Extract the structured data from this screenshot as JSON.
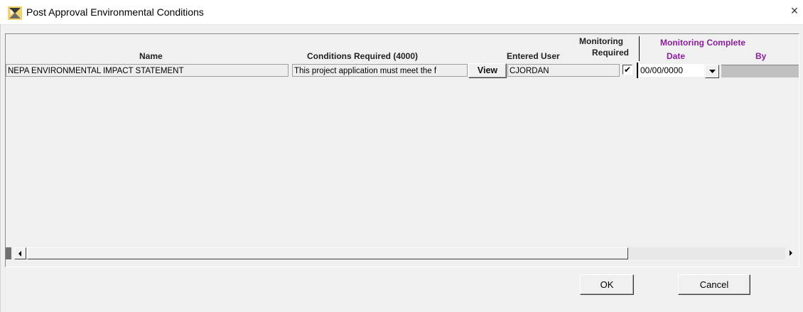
{
  "window": {
    "title": "Post Approval Environmental Conditions",
    "close_glyph": "×",
    "icon": "app-logo-icon"
  },
  "headers": {
    "name": "Name",
    "conditions": "Conditions Required (4000)",
    "entered_user": "Entered User",
    "monitoring_required_line1": "Monitoring",
    "monitoring_required_line2": "Required",
    "monitoring_complete": "Monitoring Complete",
    "date": "Date",
    "by": "By"
  },
  "rows": [
    {
      "name": "NEPA ENVIRONMENTAL IMPACT STATEMENT",
      "conditions": "This project application must meet the f",
      "view_label": "View",
      "entered_user": "CJORDAN",
      "monitoring_required": true,
      "checkbox_glyph": "✔",
      "date": "00/00/0000",
      "by": ""
    }
  ],
  "buttons": {
    "ok": "OK",
    "cancel": "Cancel"
  },
  "colors": {
    "accent_header": "#8b1e9c",
    "background": "#f0f0f0"
  }
}
